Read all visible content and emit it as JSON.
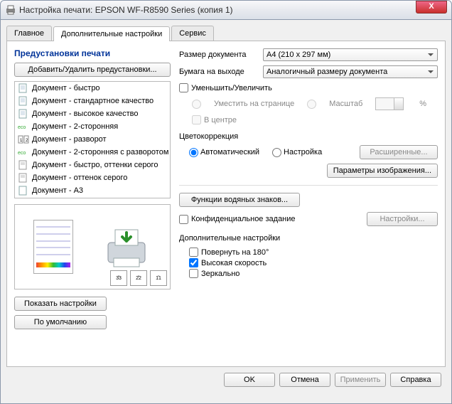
{
  "title": "Настройка печати: EPSON WF-R8590 Series (копия 1)",
  "tabs": {
    "main": "Главное",
    "extra": "Дополнительные настройки",
    "service": "Сервис"
  },
  "presets": {
    "header": "Предустановки печати",
    "add_remove": "Добавить/Удалить предустановки...",
    "items": [
      "Документ - быстро",
      "Документ - стандартное качество",
      "Документ - высокое качество",
      "Документ - 2-сторонняя",
      "Документ - разворот",
      "Документ - 2-сторонняя с разворотом",
      "Документ - быстро, оттенки серого",
      "Документ - оттенок серого",
      "Документ - А3"
    ],
    "show": "Показать настройки",
    "defaults": "По умолчанию"
  },
  "doc_size_label": "Размер документа",
  "doc_size_value": "А4 (210 x 297 мм)",
  "paper_out_label": "Бумага на выходе",
  "paper_out_value": "Аналогичный размеру документа",
  "reduce_enlarge": "Уменьшить/Увеличить",
  "fit_page": "Уместить на странице",
  "scale": "Масштаб",
  "center": "В центре",
  "pct": "%",
  "color_corr": "Цветокоррекция",
  "auto": "Автоматический",
  "manual": "Настройка",
  "advanced": "Расширенные...",
  "image_params": "Параметры изображения...",
  "watermark": "Функции водяных знаков...",
  "confidential": "Конфиденциальное задание",
  "settings": "Настройки...",
  "add_settings_label": "Дополнительные настройки",
  "rotate180": "Повернуть на 180°",
  "highspeed": "Высокая скорость",
  "mirror": "Зеркально",
  "footer": {
    "ok": "OK",
    "cancel": "Отмена",
    "apply": "Применить",
    "help": "Справка"
  }
}
